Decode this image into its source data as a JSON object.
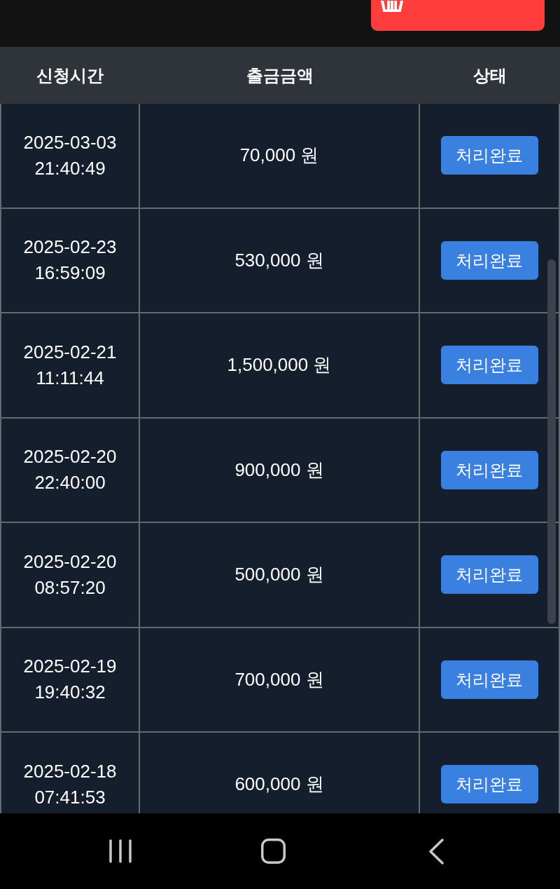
{
  "table": {
    "columns": [
      "신청시간",
      "출금금액",
      "상태"
    ],
    "rows": [
      {
        "requested_at": "2025-03-03 21:40:49",
        "amount": "70,000 원",
        "status": "처리완료"
      },
      {
        "requested_at": "2025-02-23 16:59:09",
        "amount": "530,000 원",
        "status": "처리완료"
      },
      {
        "requested_at": "2025-02-21 11:11:44",
        "amount": "1,500,000 원",
        "status": "처리완료"
      },
      {
        "requested_at": "2025-02-20 22:40:00",
        "amount": "900,000 원",
        "status": "처리완료"
      },
      {
        "requested_at": "2025-02-20 08:57:20",
        "amount": "500,000 원",
        "status": "처리완료"
      },
      {
        "requested_at": "2025-02-19 19:40:32",
        "amount": "700,000 원",
        "status": "처리완료"
      },
      {
        "requested_at": "2025-02-18 07:41:53",
        "amount": "600,000 원",
        "status": "처리완료"
      }
    ]
  }
}
